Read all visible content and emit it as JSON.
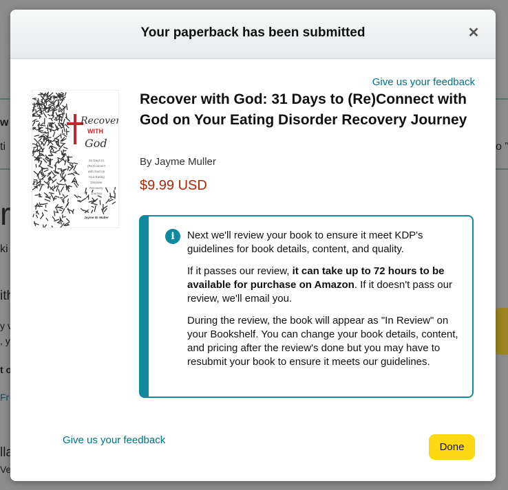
{
  "modal": {
    "title": "Your paperback has been submitted",
    "close_icon": "close-icon",
    "feedback_link_top": "Give us your feedback",
    "feedback_link_bottom": "Give us your feedback",
    "done_label": "Done"
  },
  "book": {
    "title": "Recover with God: 31 Days to (Re)Connect with God on Your Eating Disorder Recovery Journey",
    "author": "By Jayme Muller",
    "price": "$9.99 USD",
    "cover": {
      "title_line1": "Recover",
      "title_line2": "WITH",
      "title_line3": "God",
      "subtitle_lines": [
        "31 Days to",
        "(Re)Connect",
        "with God on",
        "Your Eating",
        "Disorder",
        "Recovery",
        "Journey"
      ],
      "author": "Jayme M. Muller"
    }
  },
  "info": {
    "icon": "info-icon",
    "p1": "Next we'll review your book to ensure it meet KDP's guidelines for book details, content, and quality.",
    "p2_before": "If it passes our review, ",
    "p2_bold": "it can take up to 72 hours to be available for purchase on Amazon",
    "p2_after": ". If it doesn't pass our review, we'll email you.",
    "p3": "During the review, the book will appear as \"In Review\" on your Bookshelf. You can change your book details, content, and pricing after the review's done but you may have to resubmit your book to ensure it meets our guidelines."
  },
  "background": {
    "fragments": [
      "w",
      "ti",
      "o \"a",
      "r",
      "ki",
      "ith",
      "y v",
      ", y",
      "t o",
      "Fr",
      "lla",
      "Ve"
    ]
  },
  "colors": {
    "link": "#007185",
    "price": "#b12704",
    "info_accent": "#0e8a9c",
    "button_yellow": "#ffd814"
  }
}
